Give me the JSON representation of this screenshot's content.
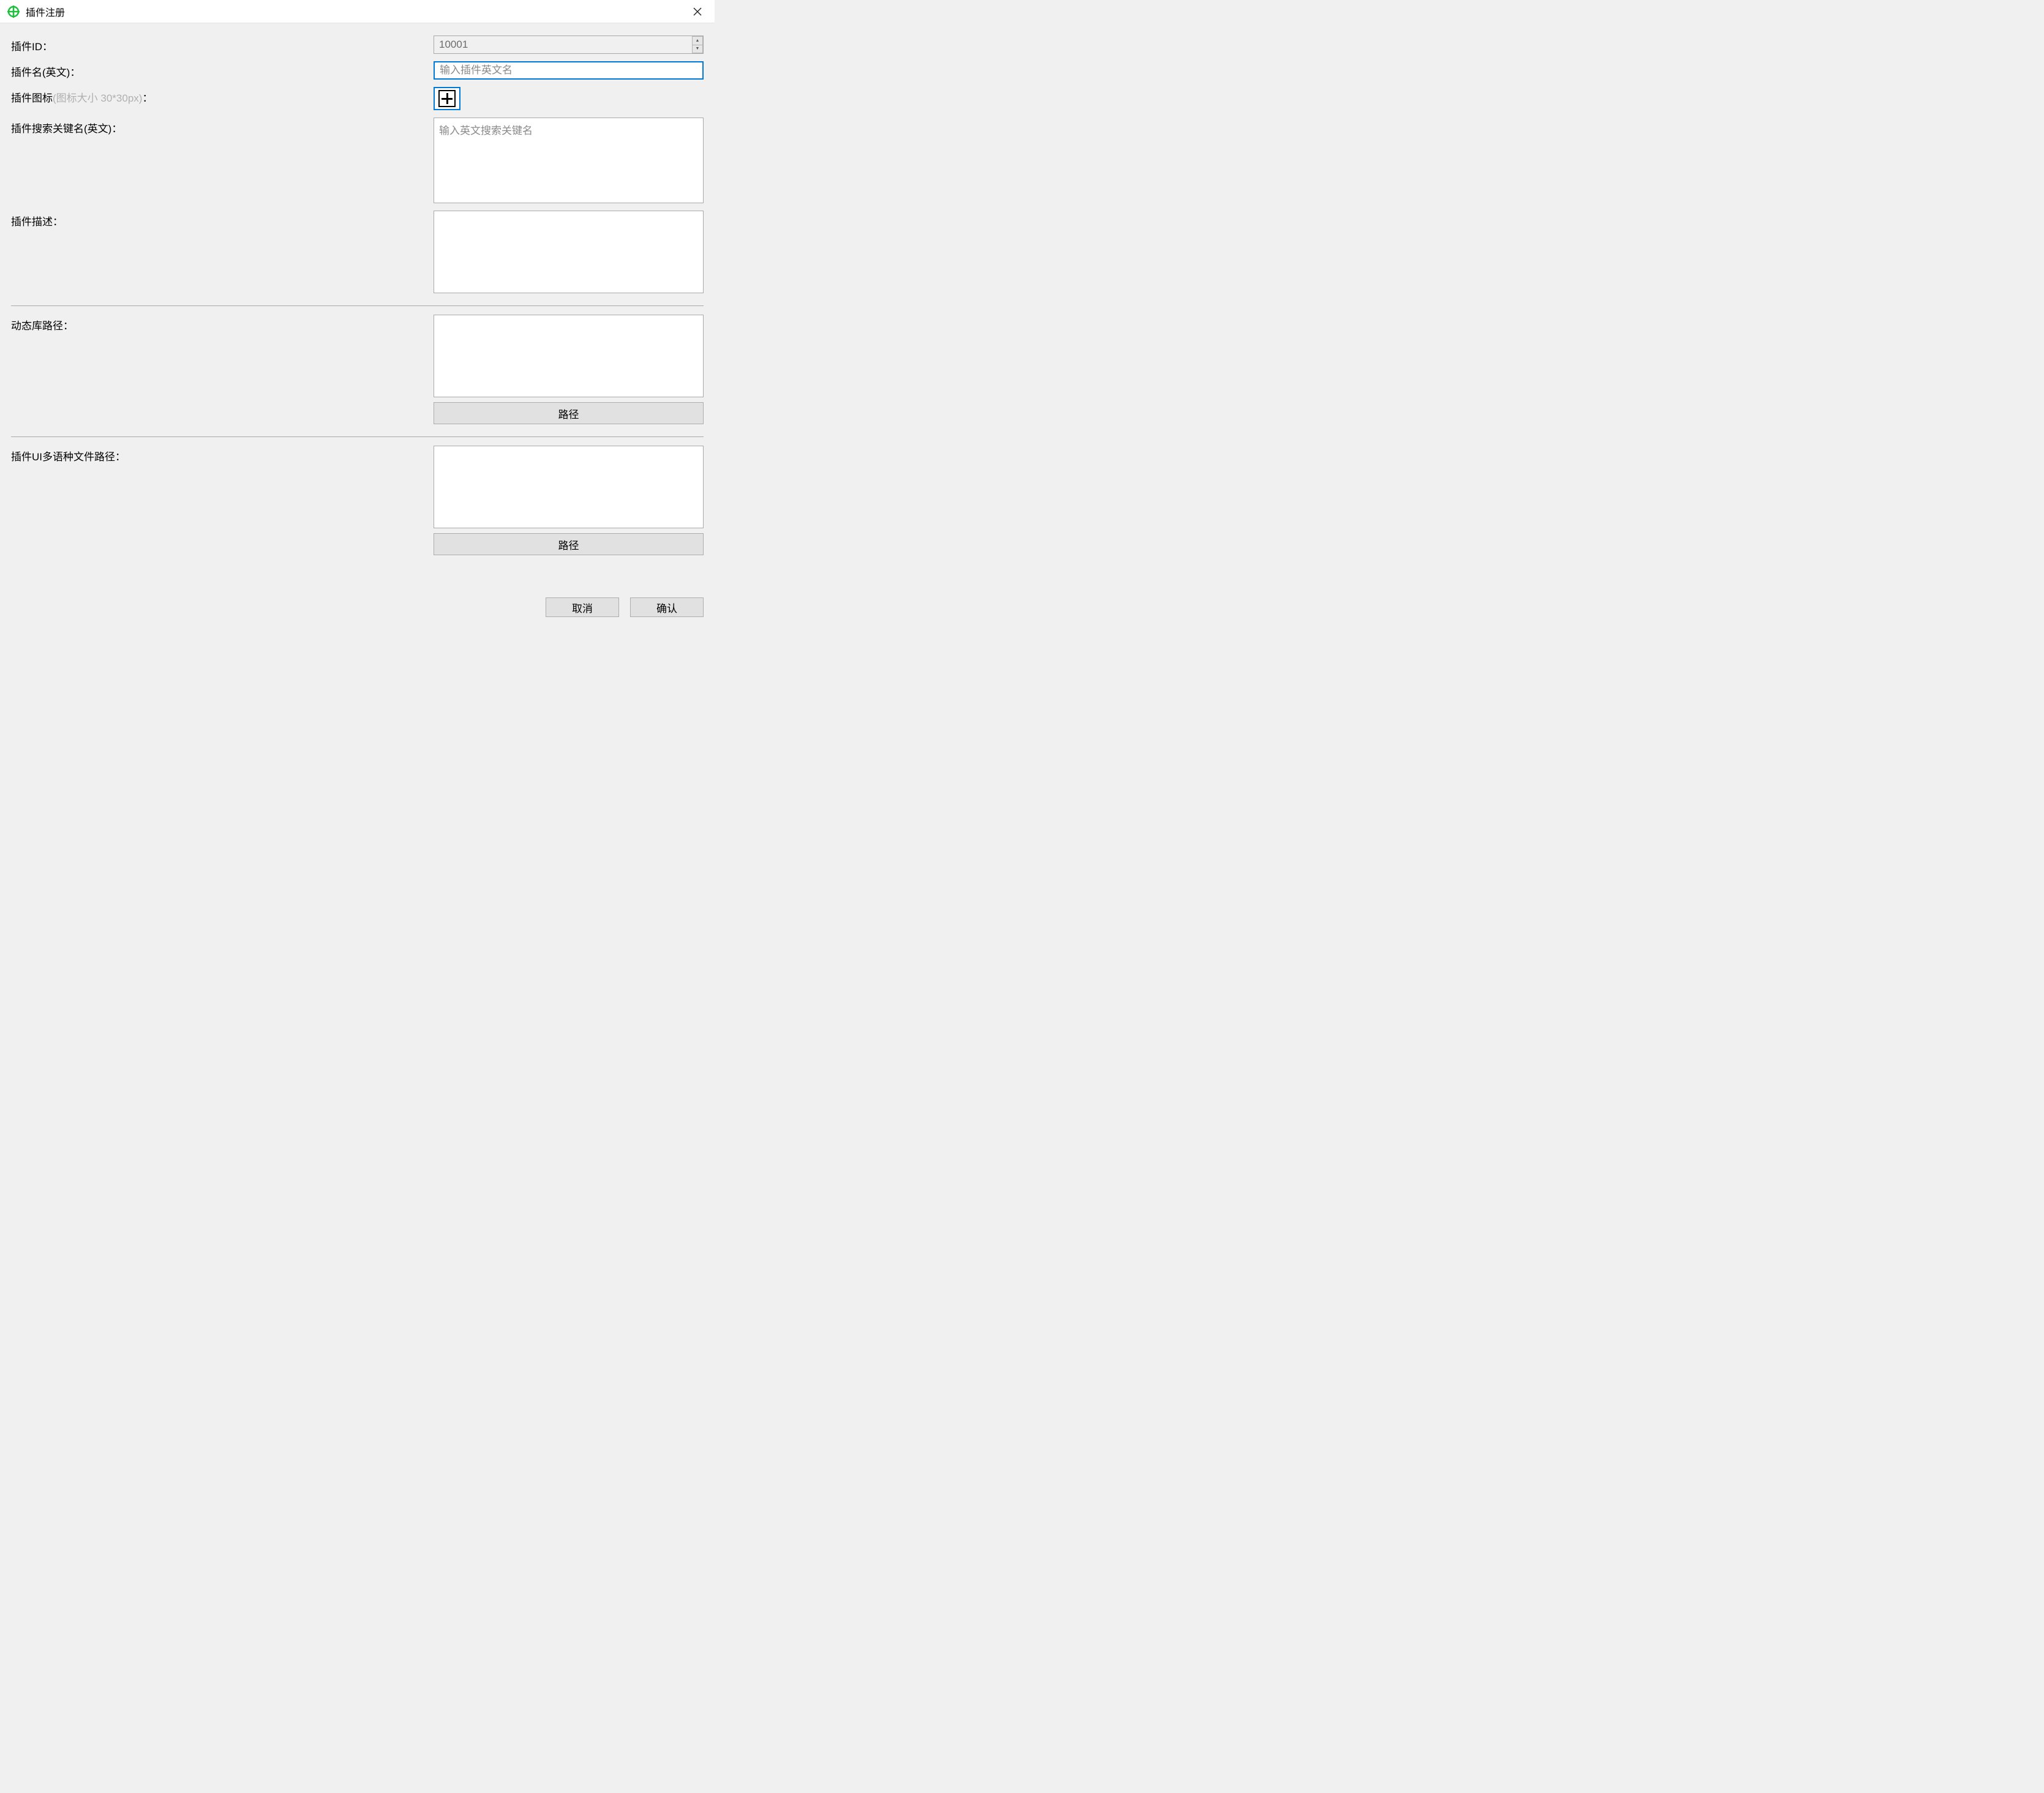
{
  "titlebar": {
    "title": "插件注册"
  },
  "form": {
    "plugin_id": {
      "label": "插件ID：",
      "value": "10001"
    },
    "plugin_name": {
      "label": "插件名(英文)：",
      "placeholder": "输入插件英文名",
      "value": ""
    },
    "plugin_icon": {
      "label_main": "插件图标",
      "label_hint": "(图标大小 30*30px)",
      "label_colon": "："
    },
    "search_key": {
      "label": "插件搜索关键名(英文)：",
      "placeholder": "输入英文搜索关键名",
      "value": ""
    },
    "description": {
      "label": "插件描述：",
      "value": ""
    },
    "library_path": {
      "label": "动态库路径：",
      "value": "",
      "path_btn": "路径"
    },
    "ui_lang_path": {
      "label": "插件UI多语种文件路径：",
      "value": "",
      "path_btn": "路径"
    }
  },
  "buttons": {
    "cancel": "取消",
    "ok": "确认"
  }
}
